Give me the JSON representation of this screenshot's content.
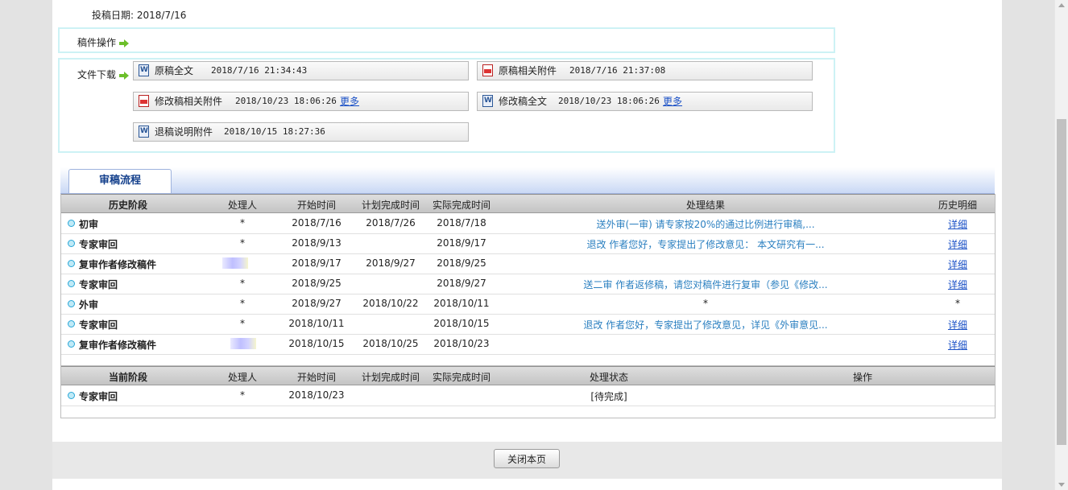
{
  "submit_date": {
    "label": "投稿日期:",
    "value": "2018/7/16"
  },
  "ops": {
    "label": "稿件操作"
  },
  "download": {
    "label": "文件下载",
    "files": [
      {
        "name": "原稿全文",
        "time": "2018/7/16 21:34:43",
        "icon": "doc-icon",
        "more": ""
      },
      {
        "name": "原稿相关附件",
        "time": "2018/7/16 21:37:08",
        "icon": "pdf-icon",
        "more": ""
      },
      {
        "name": "修改稿相关附件",
        "time": "2018/10/23 18:06:26",
        "icon": "pdf-icon",
        "more": "更多"
      },
      {
        "name": "修改稿全文",
        "time": "2018/10/23 18:06:26",
        "icon": "doc-icon",
        "more": "更多"
      },
      {
        "name": "退稿说明附件",
        "time": "2018/10/15 18:27:36",
        "icon": "doc-icon",
        "more": ""
      }
    ]
  },
  "flow": {
    "tab_label": "审稿流程"
  },
  "history": {
    "headers": [
      "历史阶段",
      "处理人",
      "开始时间",
      "计划完成时间",
      "实际完成时间",
      "处理结果",
      "历史明细"
    ],
    "rows": [
      {
        "stage": "初审",
        "handler": "*",
        "start": "2018/7/16",
        "plan": "2018/7/26",
        "actual": "2018/7/18",
        "result": "送外审(一审) 请专家按20%的通过比例进行审稿,...",
        "detail": "详细"
      },
      {
        "stage": "专家审回",
        "handler": "*",
        "start": "2018/9/13",
        "plan": "",
        "actual": "2018/9/17",
        "result": "退改 作者您好，专家提出了修改意见： 本文研究有一...",
        "detail": "详细"
      },
      {
        "stage": "复审作者修改稿件",
        "handler": "",
        "start": "2018/9/17",
        "plan": "2018/9/27",
        "actual": "2018/9/25",
        "result": "",
        "detail": "详细"
      },
      {
        "stage": "专家审回",
        "handler": "*",
        "start": "2018/9/25",
        "plan": "",
        "actual": "2018/9/27",
        "result": "送二审 作者返修稿，请您对稿件进行复审（参见《修改...",
        "detail": "详细"
      },
      {
        "stage": "外审",
        "handler": "*",
        "start": "2018/9/27",
        "plan": "2018/10/22",
        "actual": "2018/10/11",
        "result": "*",
        "detail": "*"
      },
      {
        "stage": "专家审回",
        "handler": "*",
        "start": "2018/10/11",
        "plan": "",
        "actual": "2018/10/15",
        "result": "退改 作者您好，专家提出了修改意见，详见《外审意见...",
        "detail": "详细"
      },
      {
        "stage": "复审作者修改稿件",
        "handler": "",
        "start": "2018/10/15",
        "plan": "2018/10/25",
        "actual": "2018/10/23",
        "result": "",
        "detail": "详细"
      }
    ]
  },
  "current": {
    "headers": [
      "当前阶段",
      "处理人",
      "开始时间",
      "计划完成时间",
      "实际完成时间",
      "处理状态",
      "操作"
    ],
    "rows": [
      {
        "stage": "专家审回",
        "handler": "*",
        "start": "2018/10/23",
        "plan": "",
        "actual": "",
        "status": "[待完成]",
        "ops": ""
      }
    ]
  },
  "footer": {
    "close_label": "关闭本页"
  }
}
